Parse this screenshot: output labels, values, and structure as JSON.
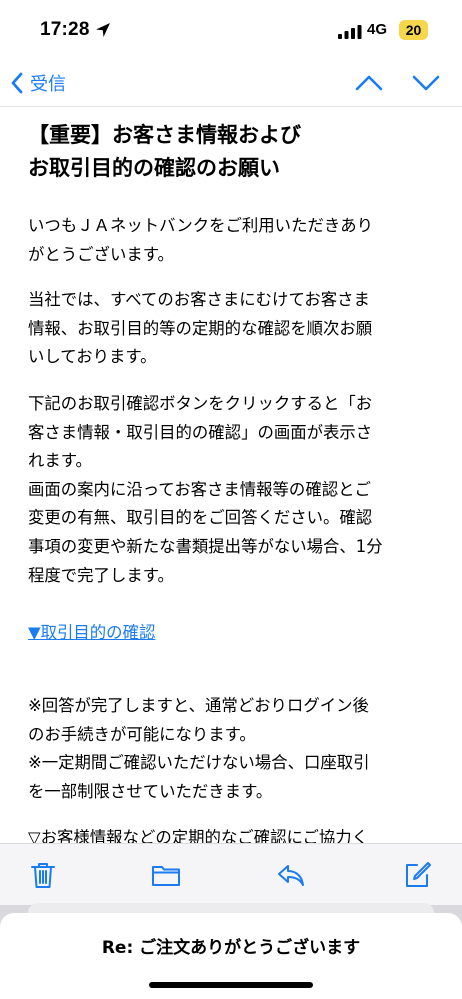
{
  "status_bar": {
    "time": "17:28",
    "network": "4G",
    "battery": "20",
    "icons": [
      "location-arrow-icon",
      "cellular-signal-icon",
      "battery-icon"
    ]
  },
  "nav": {
    "back_label": "受信",
    "icons": [
      "chevron-left-icon",
      "chevron-up-icon",
      "chevron-down-icon"
    ]
  },
  "email": {
    "subject": "【重要】お客さま情報および\nお取引目的の確認のお願い",
    "paragraphs": [
      "いつもＪＡネットバンクをご利用いただきあり\nがとうございます。",
      "当社では、すべてのお客さまにむけてお客さま\n情報、お取引目的等の定期的な確認を順次お願\nいしております。",
      "下記のお取引確認ボタンをクリックすると「お\n客さま情報・取引目的の確認」の画面が表示さ\nれます。\n画面の案内に沿ってお客さま情報等の確認とご\n変更の有無、取引目的をご回答ください。確認\n事項の変更や新たな書類提出等がない場合、1分\n程度で完了します。",
      "※回答が完了しますと、通常どおりログイン後\nのお手続きが可能になります。\n※一定期間ご確認いただけない場合、口座取引\nを一部制限させていただきます。",
      "▽お客様情報などの定期的なご確認にご協力く"
    ],
    "link": "▼取引目的の確認"
  },
  "toolbar": {
    "icons": [
      "trash-icon",
      "folder-icon",
      "reply-icon",
      "compose-icon"
    ]
  },
  "draft": {
    "title": "Re: ご注文ありがとうございます"
  },
  "colors": {
    "accent": "#1a7cf0",
    "battery": "#f6d64a",
    "toolbar_bg": "#f5f5f7"
  }
}
